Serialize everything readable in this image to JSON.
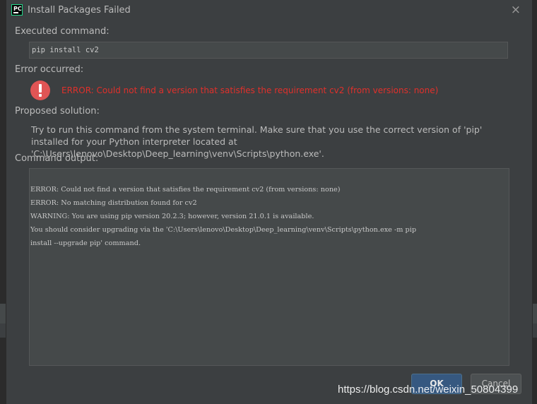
{
  "window": {
    "title": "Install Packages Failed",
    "app_icon_text": "PC",
    "close_glyph": "×"
  },
  "executed": {
    "label": "Executed command:",
    "command": "pip install cv2"
  },
  "error": {
    "label": "Error occurred:",
    "message": "ERROR: Could not find a version that satisfies the requirement cv2 (from versions: none)",
    "color": "#e0302b"
  },
  "solution": {
    "label": "Proposed solution:",
    "text": "Try to run this command from the system terminal. Make sure that you use the correct version of 'pip' installed for your Python interpreter located at 'C:\\Users\\lenovo\\Desktop\\Deep_learning\\venv\\Scripts\\python.exe'."
  },
  "output": {
    "label": "Command output:",
    "lines": [
      "ERROR: Could not find a version that satisfies the requirement cv2 (from versions: none)",
      "ERROR: No matching distribution found for cv2",
      "WARNING: You are using pip version 20.2.3; however, version 21.0.1 is available.",
      "You should consider upgrading via the 'C:\\Users\\lenovo\\Desktop\\Deep_learning\\venv\\Scripts\\python.exe -m pip",
      "install --upgrade pip' command."
    ]
  },
  "buttons": {
    "ok": "OK",
    "cancel": "Cancel"
  },
  "watermark": "https://blog.csdn.net/weixin_50804399"
}
